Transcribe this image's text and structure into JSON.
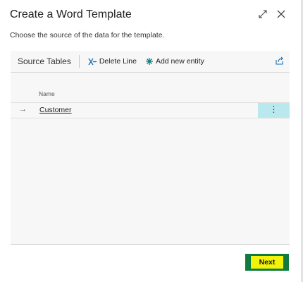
{
  "dialog": {
    "title": "Create a Word Template",
    "subtitle": "Choose the source of the data for the template."
  },
  "toolbar": {
    "title": "Source Tables",
    "delete_label": "Delete Line",
    "add_label": "Add new entity"
  },
  "table": {
    "columns": [
      "Name"
    ],
    "rows": [
      {
        "arrow": "→",
        "name": "Customer",
        "menu": "⋮"
      }
    ]
  },
  "footer": {
    "next_label": "Next"
  },
  "colors": {
    "accent": "#0f7b3f",
    "selected_row_menu": "#b9e9ee",
    "highlight": "#f2f20a"
  },
  "icons": [
    "expand-icon",
    "close-icon",
    "delete-line-icon",
    "add-entity-icon",
    "share-icon",
    "row-arrow-icon",
    "more-options-icon"
  ]
}
